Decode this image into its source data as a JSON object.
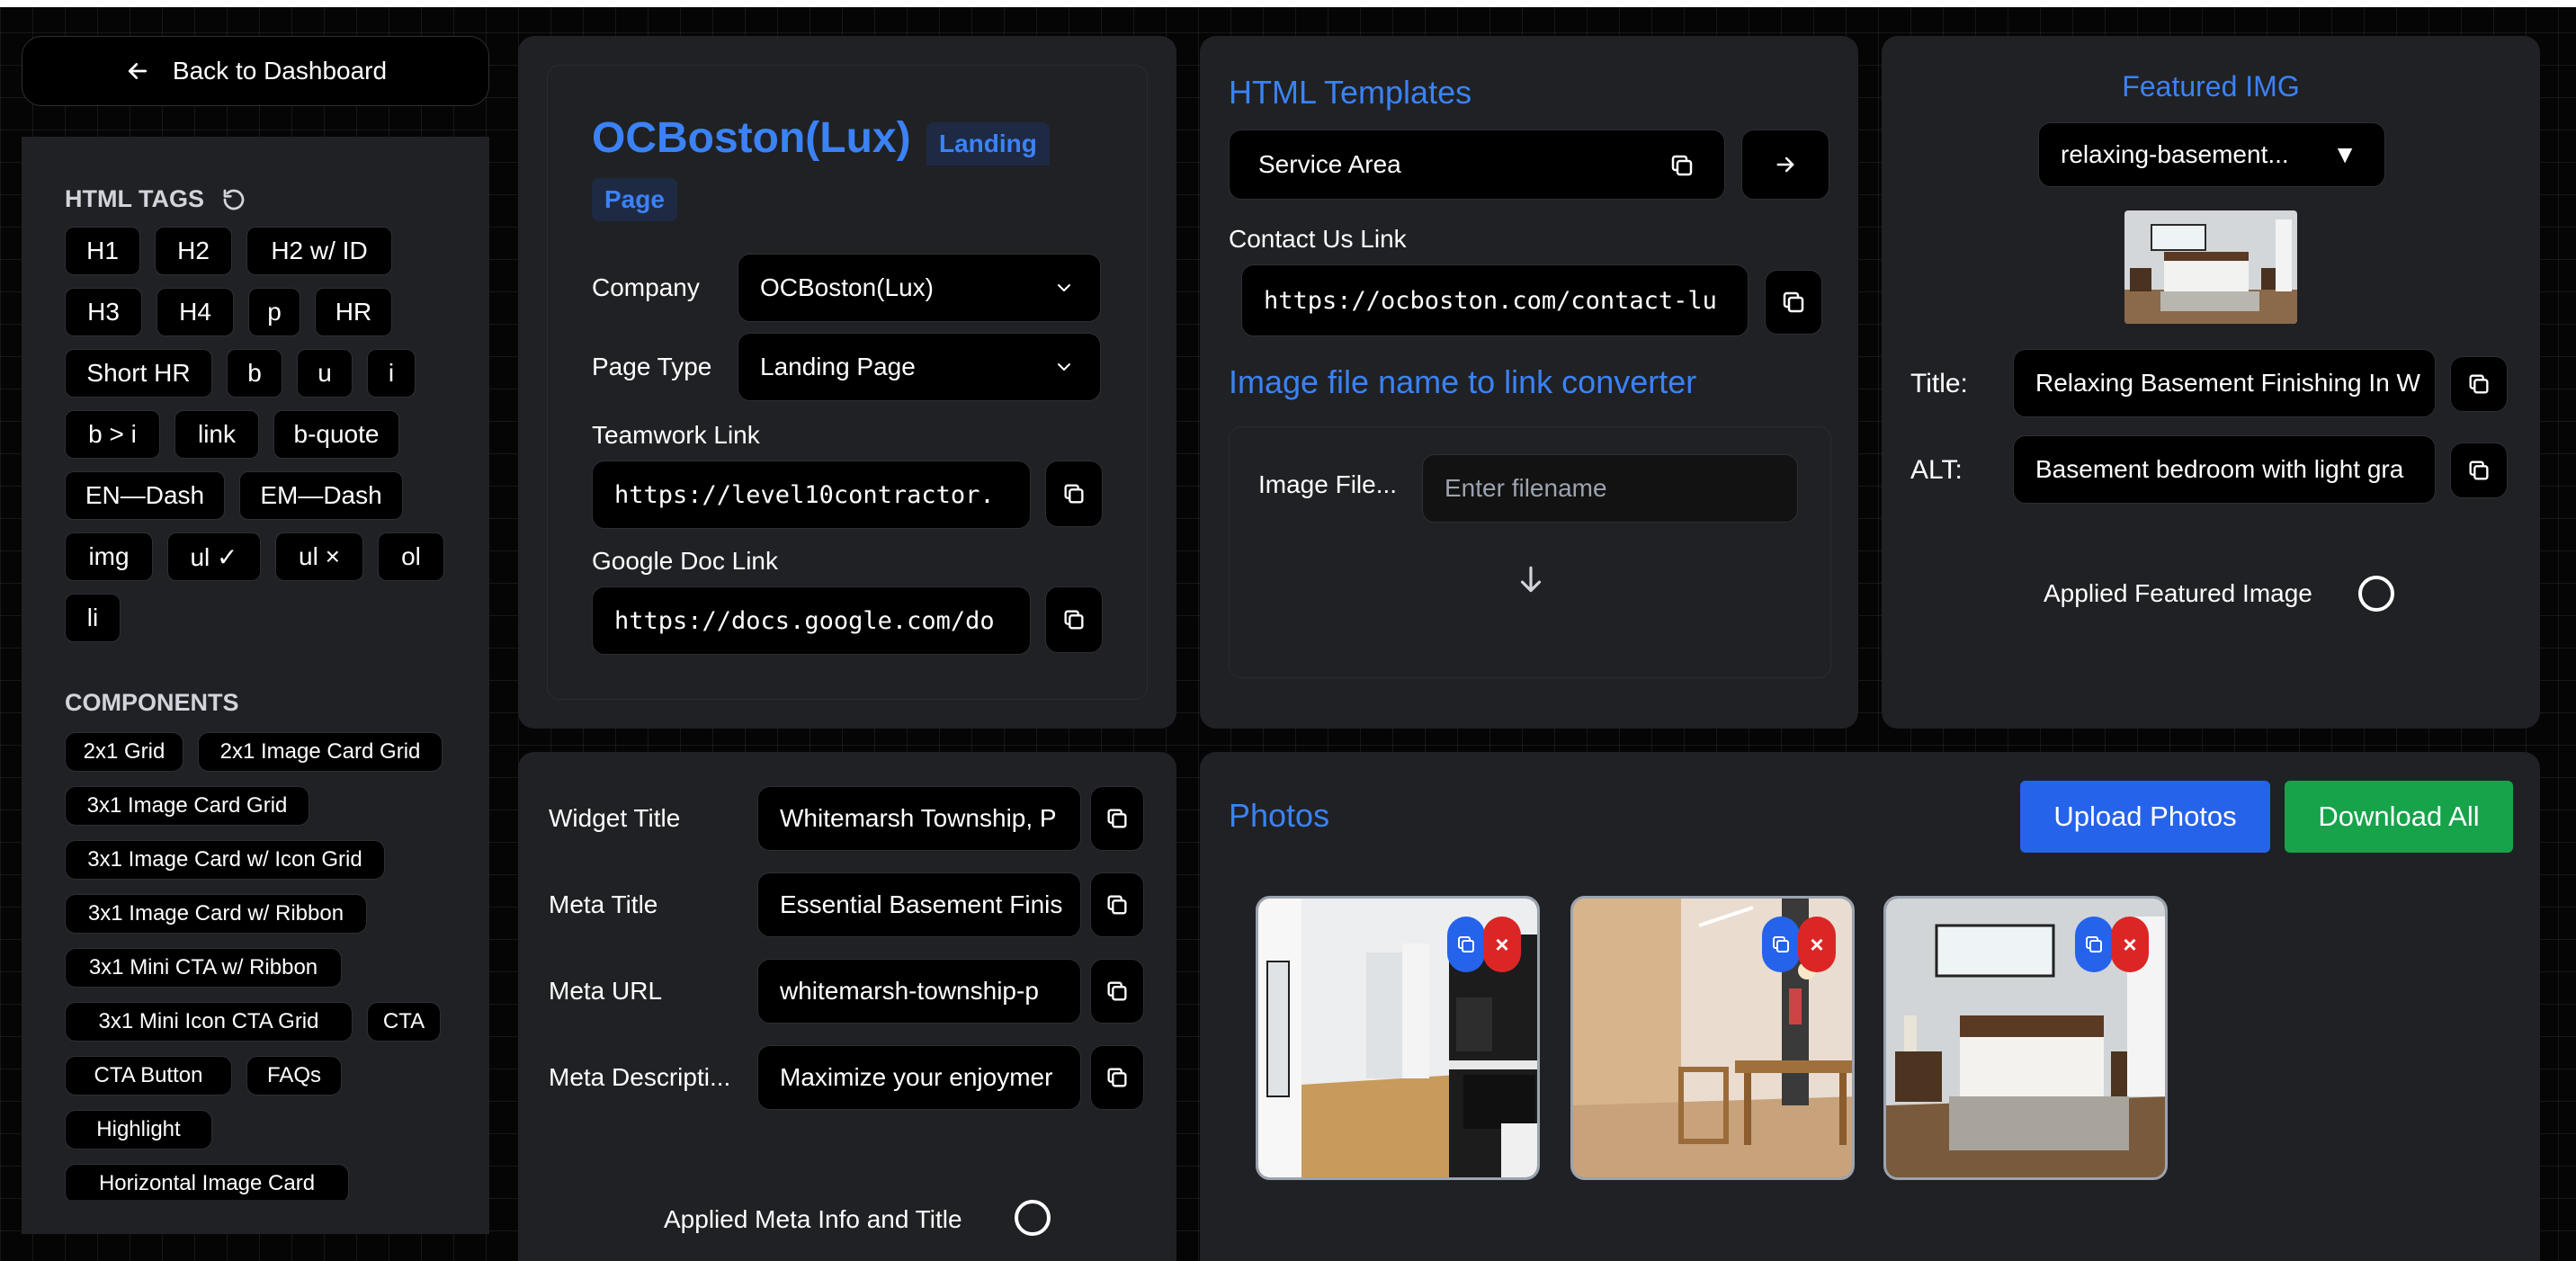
{
  "nav": {
    "back_label": "Back to Dashboard"
  },
  "sidebar": {
    "html_tags_title": "HTML TAGS",
    "tags": [
      "H1",
      "H2",
      "H2 w/ ID",
      "H3",
      "H4",
      "p",
      "HR",
      "Short HR",
      "b",
      "u",
      "i",
      "b > i",
      "link",
      "b-quote",
      "EN—Dash",
      "EM—Dash",
      "img",
      "ul ✓",
      "ul ×",
      "ol",
      "li"
    ],
    "components_title": "COMPONENTS",
    "components": [
      "2x1 Grid",
      "2x1 Image Card Grid",
      "3x1 Image Card Grid",
      "3x1 Image Card w/ Icon Grid",
      "3x1 Image Card w/ Ribbon",
      "3x1 Mini CTA w/ Ribbon",
      "3x1 Mini Icon CTA Grid",
      "CTA",
      "CTA Button",
      "FAQs",
      "Highlight",
      "Horizontal Image Card"
    ]
  },
  "project": {
    "name": "OCBoston(Lux)",
    "badge_line1": "Landing",
    "badge_line2": "Page",
    "company_label": "Company",
    "company_value": "OCBoston(Lux)",
    "page_type_label": "Page Type",
    "page_type_value": "Landing Page",
    "teamwork_label": "Teamwork Link",
    "teamwork_value": "https://level10contractor.",
    "gdoc_label": "Google Doc Link",
    "gdoc_value": "https://docs.google.com/do"
  },
  "meta": {
    "widget_title_label": "Widget Title",
    "widget_title_value": "Whitemarsh Township, P",
    "meta_title_label": "Meta Title",
    "meta_title_value": "Essential Basement Finis",
    "meta_url_label": "Meta URL",
    "meta_url_value": "whitemarsh-township-p",
    "meta_desc_label": "Meta Descripti...",
    "meta_desc_value": "Maximize your enjoymer",
    "applied_label": "Applied Meta Info and Title"
  },
  "templates": {
    "title": "HTML Templates",
    "template_value": "Service Area",
    "contact_label": "Contact Us Link",
    "contact_value": "https://ocboston.com/contact-lu",
    "converter_title": "Image file name to link converter",
    "image_file_label": "Image File...",
    "image_file_placeholder": "Enter filename"
  },
  "featured": {
    "title": "Featured IMG",
    "select_value": "relaxing-basement...",
    "select_arrow": "▼",
    "title_label": "Title:",
    "title_value": "Relaxing Basement Finishing In W",
    "alt_label": "ALT:",
    "alt_value": "Basement bedroom with light gra",
    "applied_label": "Applied Featured Image"
  },
  "photos": {
    "title": "Photos",
    "upload_label": "Upload Photos",
    "download_label": "Download All",
    "delete_glyph": "×"
  },
  "colors": {
    "accent_blue": "#3b82f6",
    "upload_blue": "#2563eb",
    "download_green": "#16a34a",
    "delete_red": "#dc2626",
    "panel": "#202124"
  }
}
